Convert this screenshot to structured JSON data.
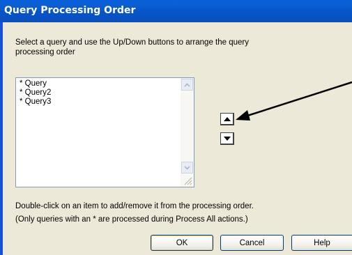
{
  "window": {
    "title": "Query Processing Order"
  },
  "instruction": "Select a query and use the Up/Down buttons to arrange the query processing order",
  "query_list": {
    "items": [
      "* Query",
      "* Query2",
      "* Query3"
    ]
  },
  "order_buttons": {
    "up_icon": "up-triangle-icon",
    "down_icon": "down-triangle-icon"
  },
  "notes": {
    "double_click": "Double-click on an item to add/remove it from the processing order.",
    "asterisk_info": "(Only queries with an * are processed during Process All actions.)"
  },
  "buttons": {
    "ok": "OK",
    "cancel": "Cancel",
    "help": "Help"
  },
  "colors": {
    "titlebar": "#0a54c8",
    "dialog_background": "#ece9d8",
    "button_border": "#003c74"
  }
}
